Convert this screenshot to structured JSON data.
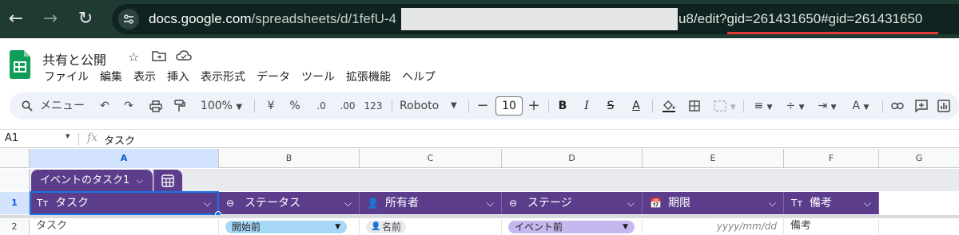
{
  "browser": {
    "url_host": "docs.google.com",
    "url_path_start": "/spreadsheets/d/1fefU-4",
    "url_path_end": "u8/edit?gid=261431650#gid=261431650"
  },
  "document": {
    "title": "共有と公開"
  },
  "menu": [
    "ファイル",
    "編集",
    "表示",
    "挿入",
    "表示形式",
    "データ",
    "ツール",
    "拡張機能",
    "ヘルプ"
  ],
  "toolbar": {
    "search_label": "メニュー",
    "zoom": "100%",
    "currency": "¥",
    "percent": "%",
    "decrease_decimal": ".0",
    "increase_decimal": ".00",
    "number_format": "123",
    "font": "Roboto",
    "font_size": "10"
  },
  "formula_bar": {
    "cell_ref": "A1",
    "fx": "fx",
    "value": "タスク"
  },
  "columns": [
    "A",
    "B",
    "C",
    "D",
    "E",
    "F",
    "G"
  ],
  "rows": [
    "1",
    "2"
  ],
  "table": {
    "name": "イベントのタスク1",
    "headers": [
      {
        "icon": "Tт",
        "label": "タスク"
      },
      {
        "icon": "⊖",
        "label": "ステータス"
      },
      {
        "icon": "👤",
        "label": "所有者"
      },
      {
        "icon": "⊖",
        "label": "ステージ"
      },
      {
        "icon": "📅",
        "label": "期限"
      },
      {
        "icon": "Tт",
        "label": "備考"
      }
    ],
    "row2": {
      "task": "タスク",
      "status": "開始前",
      "owner": "名前",
      "stage": "イベント前",
      "due_placeholder": "yyyy/mm/dd",
      "notes": "備考"
    }
  },
  "colors": {
    "table_header": "#5b3d8c",
    "status_chip": "#a8d8f8",
    "stage_chip": "#c7b7ef",
    "selection": "#1a73e8"
  }
}
